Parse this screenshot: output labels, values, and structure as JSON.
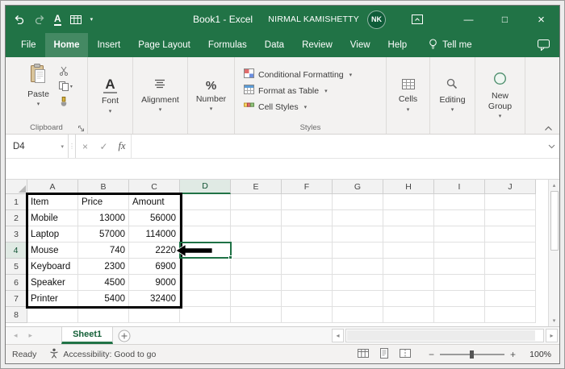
{
  "titlebar": {
    "title": "Book1 - Excel",
    "user_name": "NIRMAL KAMISHETTY",
    "user_initials": "NK"
  },
  "ribbon_tabs": {
    "items": [
      {
        "label": "File",
        "active": false
      },
      {
        "label": "Home",
        "active": true
      },
      {
        "label": "Insert",
        "active": false
      },
      {
        "label": "Page Layout",
        "active": false
      },
      {
        "label": "Formulas",
        "active": false
      },
      {
        "label": "Data",
        "active": false
      },
      {
        "label": "Review",
        "active": false
      },
      {
        "label": "View",
        "active": false
      },
      {
        "label": "Help",
        "active": false
      }
    ],
    "tell_me_label": "Tell me"
  },
  "ribbon": {
    "paste_label": "Paste",
    "font_label": "Font",
    "alignment_label": "Alignment",
    "number_label": "Number",
    "conditional_formatting_label": "Conditional Formatting",
    "format_as_table_label": "Format as Table",
    "cell_styles_label": "Cell Styles",
    "cells_label": "Cells",
    "editing_label": "Editing",
    "new_group_label": "New Group",
    "clipboard_group_label": "Clipboard",
    "styles_group_label": "Styles"
  },
  "formula_bar": {
    "name_box_value": "D4",
    "fx_label": "fx",
    "formula_value": ""
  },
  "sheet": {
    "columns": [
      "A",
      "B",
      "C",
      "D",
      "E",
      "F",
      "G",
      "H",
      "I",
      "J"
    ],
    "row_count": 8,
    "selected_column": "D",
    "selected_row": 4,
    "cell_values": [
      [
        "Item",
        "Price",
        "Amount"
      ],
      [
        "Mobile",
        "13000",
        "56000"
      ],
      [
        "Laptop",
        "57000",
        "114000"
      ],
      [
        "Mouse",
        "740",
        "2220"
      ],
      [
        "Keyboard",
        "2300",
        "6900"
      ],
      [
        "Speaker",
        "4500",
        "9000"
      ],
      [
        "Printer",
        "5400",
        "32400"
      ]
    ]
  },
  "sheet_tabs": {
    "active_tab": "Sheet1"
  },
  "status_bar": {
    "ready_label": "Ready",
    "accessibility_label": "Accessibility: Good to go",
    "zoom_level": "100%"
  },
  "icons": {
    "underline_letter": "A",
    "dropdown_caret": "▾",
    "minimize": "—",
    "maximize": "□",
    "close": "×",
    "cancel": "×",
    "enter_check": "✓",
    "nav_left": "◂",
    "nav_right": "▸",
    "scroll_up": "▴",
    "scroll_down": "▾",
    "sizer_dots": "⋮",
    "zoom_out": "−",
    "zoom_in": "+"
  },
  "colors": {
    "excel_green": "#217346",
    "selection_green": "#1e7145",
    "table_border": "#000000"
  }
}
